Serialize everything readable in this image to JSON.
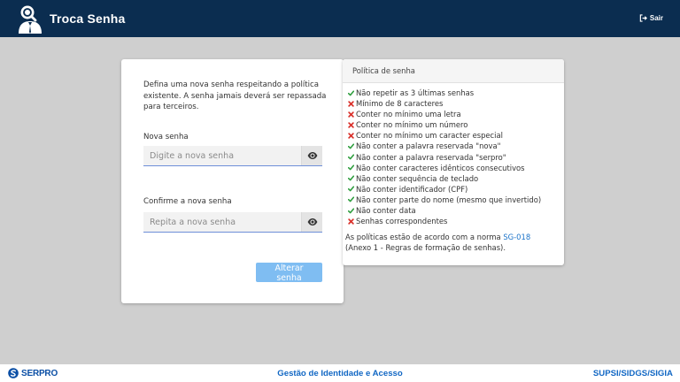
{
  "header": {
    "title": "Troca Senha",
    "logout_label": "Sair",
    "color": "#0b2d50"
  },
  "form": {
    "intro": "Defina uma nova senha respeitando a política existente. A senha jamais deverá ser repassada para terceiros.",
    "new_password": {
      "label": "Nova senha",
      "placeholder": "Digite a nova senha",
      "value": ""
    },
    "confirm_password": {
      "label": "Confirme a nova senha",
      "placeholder": "Repita a nova senha",
      "value": ""
    },
    "submit_label": "Alterar senha",
    "submit_color": "#7fbdf2"
  },
  "policy": {
    "title": "Política de senha",
    "rules": [
      {
        "text": "Não repetir as 3 últimas senhas",
        "ok": true
      },
      {
        "text": "Mínimo de 8 caracteres",
        "ok": false
      },
      {
        "text": "Conter no mínimo uma letra",
        "ok": false
      },
      {
        "text": "Conter no mínimo um número",
        "ok": false
      },
      {
        "text": "Conter no mínimo um caracter especial",
        "ok": false
      },
      {
        "text": "Não conter a palavra reservada \"nova\"",
        "ok": true
      },
      {
        "text": "Não conter a palavra reservada \"serpro\"",
        "ok": true
      },
      {
        "text": "Não conter caracteres idênticos consecutivos",
        "ok": true
      },
      {
        "text": "Não conter sequência de teclado",
        "ok": true
      },
      {
        "text": "Não conter identificador (CPF)",
        "ok": true
      },
      {
        "text": "Não conter parte do nome (mesmo que invertido)",
        "ok": true
      },
      {
        "text": "Não conter data",
        "ok": true
      },
      {
        "text": "Senhas correspondentes",
        "ok": false
      }
    ],
    "ok_color": "#2e9e3e",
    "fail_color": "#d9302a",
    "note_before": "As políticas estão de acordo com a norma ",
    "note_link": "SG-018",
    "note_after": " (Anexo 1 - Regras de formação de senhas)."
  },
  "footer": {
    "brand": "SERPRO",
    "center": "Gestão de Identidade e Acesso",
    "right": "SUPSI/SIDGS/SIGIA"
  }
}
